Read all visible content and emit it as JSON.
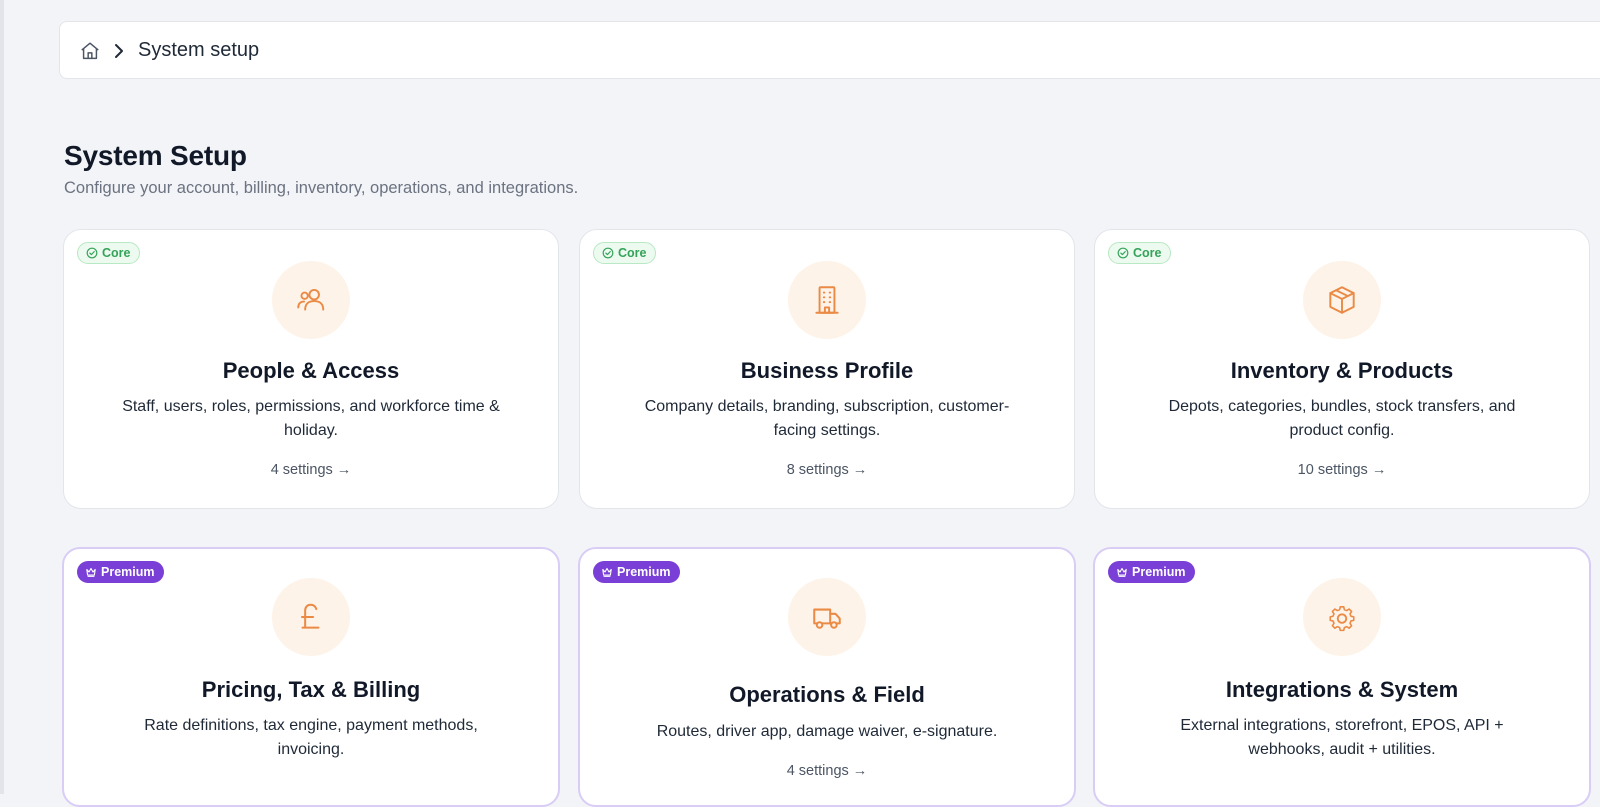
{
  "breadcrumb": {
    "current": "System setup"
  },
  "page": {
    "title": "System Setup",
    "subtitle": "Configure your account, billing, inventory, operations, and integrations."
  },
  "cards": [
    {
      "badge": "Core",
      "tier": "core",
      "icon": "users-icon",
      "title": "People & Access",
      "desc": "Staff, users, roles, permissions, and workforce time & holiday.",
      "link": "4 settings →"
    },
    {
      "badge": "Core",
      "tier": "core",
      "icon": "building-icon",
      "title": "Business Profile",
      "desc": "Company details, branding, subscription, customer-facing settings.",
      "link": "8 settings →"
    },
    {
      "badge": "Core",
      "tier": "core",
      "icon": "box-icon",
      "title": "Inventory & Products",
      "desc": "Depots, categories, bundles, stock transfers, and product config.",
      "link": "10 settings →"
    },
    {
      "badge": "Premium",
      "tier": "premium",
      "icon": "pound-icon",
      "title": "Pricing, Tax & Billing",
      "desc": "Rate definitions, tax engine, payment methods, invoicing.",
      "link": ""
    },
    {
      "badge": "Premium",
      "tier": "premium",
      "icon": "truck-icon",
      "title": "Operations & Field",
      "desc": "Routes, driver app, damage waiver, e-signature.",
      "link": "4 settings →"
    },
    {
      "badge": "Premium",
      "tier": "premium",
      "icon": "gear-icon",
      "title": "Integrations & System",
      "desc": "External integrations, storefront, EPOS, API + webhooks, audit + utilities.",
      "link": ""
    }
  ],
  "colors": {
    "accent_orange": "#ea8a45",
    "core_green": "#35a35a",
    "premium_purple": "#7a3fd6",
    "background": "#f3f4f8"
  }
}
